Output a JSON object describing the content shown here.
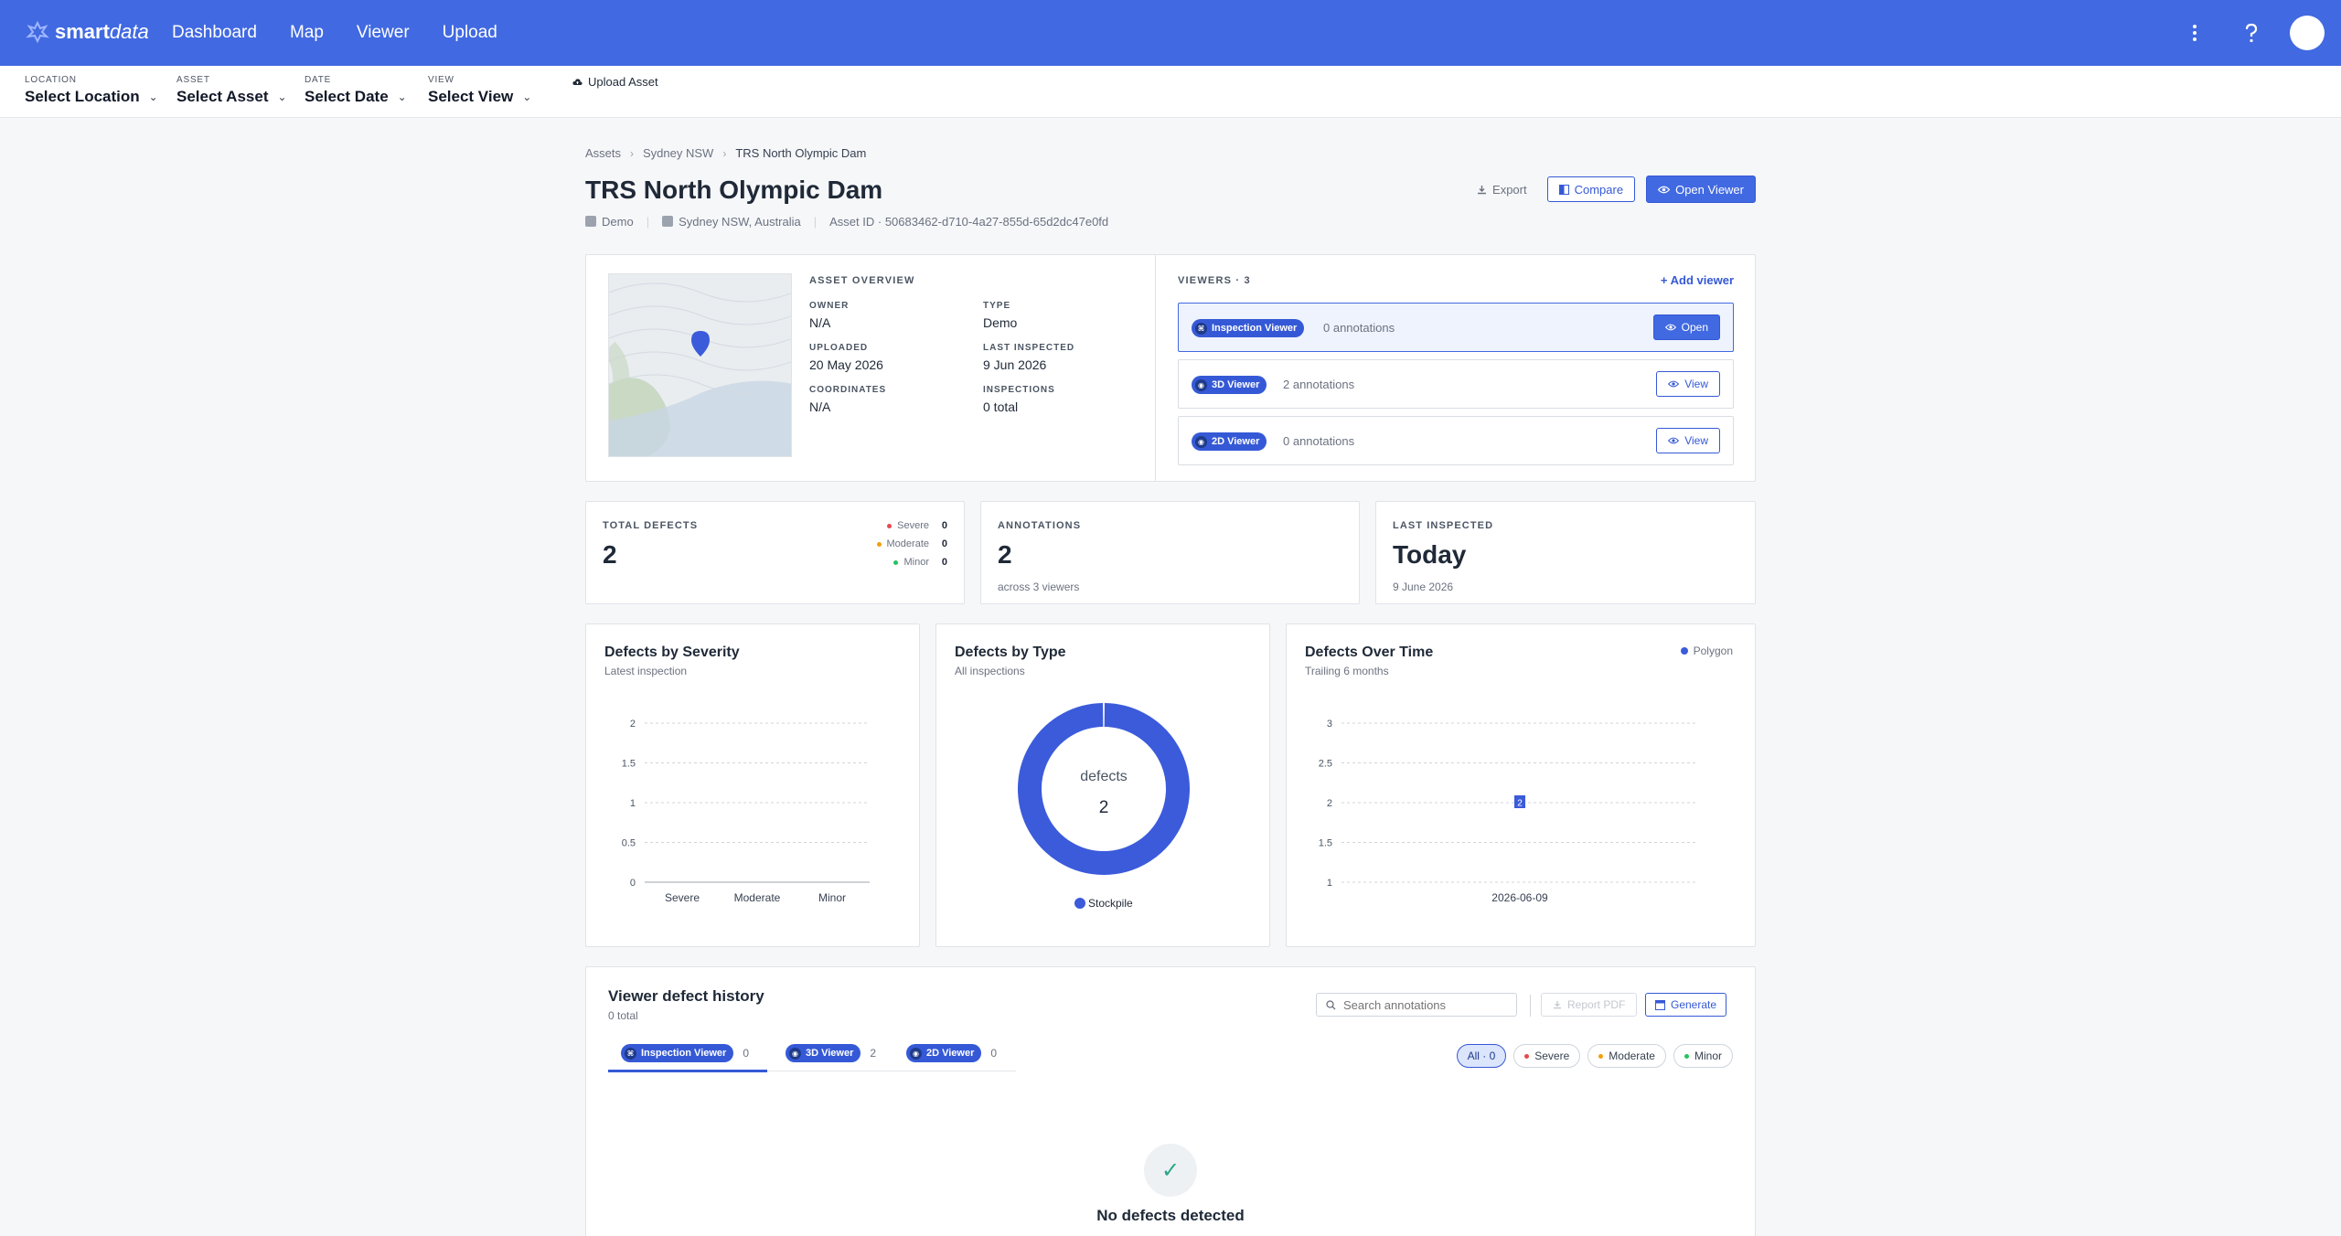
{
  "app": {
    "logo_bold": "smart",
    "logo_light": "data",
    "nav": [
      "Dashboard",
      "Map",
      "Viewer",
      "Upload"
    ]
  },
  "selectors": [
    {
      "label": "LOCATION",
      "value": "Select Location"
    },
    {
      "label": "ASSET",
      "value": "Select Asset"
    },
    {
      "label": "DATE",
      "value": "Select Date"
    },
    {
      "label": "VIEW",
      "value": "Select View"
    }
  ],
  "upload_asset": "Upload Asset",
  "breadcrumb": [
    "Assets",
    "Sydney NSW",
    "TRS North Olympic Dam"
  ],
  "asset": {
    "title": "TRS North Olympic Dam",
    "type_tag": "Demo",
    "location": "Sydney NSW, Australia",
    "asset_id": "Asset ID · 50683462-d710-4a27-855d-65d2dc47e0fd"
  },
  "actions": {
    "export": "Export",
    "compare": "Compare",
    "open_viewer": "Open Viewer"
  },
  "overview": {
    "heading": "ASSET OVERVIEW",
    "fields": [
      {
        "key": "OWNER",
        "value": "N/A"
      },
      {
        "key": "TYPE",
        "value": "Demo"
      },
      {
        "key": "UPLOADED",
        "value": "20 May 2026"
      },
      {
        "key": "LAST INSPECTED",
        "value": "9 Jun 2026"
      },
      {
        "key": "COORDINATES",
        "value": "N/A"
      },
      {
        "key": "INSPECTIONS",
        "value": "0 total"
      }
    ]
  },
  "viewers": {
    "heading": "VIEWERS · 3",
    "add": "+ Add viewer",
    "items": [
      {
        "name": "Inspection Viewer",
        "count": "0 annotations",
        "button": "Open"
      },
      {
        "name": "3D Viewer",
        "count": "2 annotations",
        "button": "View"
      },
      {
        "name": "2D Viewer",
        "count": "0 annotations",
        "button": "View"
      }
    ]
  },
  "stats": {
    "total_defects": {
      "label": "TOTAL DEFECTS",
      "value": "2",
      "severity": [
        {
          "name": "Severe",
          "count": "0",
          "color": "#e5484d"
        },
        {
          "name": "Moderate",
          "count": "0",
          "color": "#f59e0b"
        },
        {
          "name": "Minor",
          "count": "0",
          "color": "#22c55e"
        }
      ]
    },
    "annotations": {
      "label": "ANNOTATIONS",
      "value": "2",
      "sub": "across 3 viewers"
    },
    "last_inspected": {
      "label": "LAST INSPECTED",
      "value": "Today",
      "sub": "9 June 2026"
    }
  },
  "charts": {
    "severity": {
      "title": "Defects by Severity",
      "subtitle": "Latest inspection"
    },
    "type": {
      "title": "Defects by Type",
      "subtitle": "All inspections",
      "center_label": "defects",
      "center_value": "2"
    },
    "time": {
      "title": "Defects Over Time",
      "subtitle": "Trailing 6 months"
    }
  },
  "chart_data": [
    {
      "type": "bar",
      "title": "Defects by Severity",
      "subtitle": "Latest inspection",
      "categories": [
        "Severe",
        "Moderate",
        "Minor"
      ],
      "values": [
        0,
        0,
        0
      ],
      "ylim": [
        0,
        2
      ],
      "yticks": [
        "0",
        "0.5",
        "1",
        "1.5",
        "2"
      ],
      "grid": true
    },
    {
      "type": "pie",
      "title": "Defects by Type",
      "subtitle": "All inspections",
      "labels": [
        "Stockpile"
      ],
      "values": [
        2
      ],
      "colors": [
        "#3b5bdb"
      ],
      "donut": true,
      "legend": "bottom"
    },
    {
      "type": "line",
      "title": "Defects Over Time",
      "subtitle": "Trailing 6 months",
      "x": [
        "2026-06-09"
      ],
      "series": [
        {
          "name": "Polygon",
          "values": [
            2
          ]
        }
      ],
      "ylim": [
        1,
        3
      ],
      "yticks": [
        "1",
        "1.5",
        "2",
        "2.5",
        "3"
      ],
      "data_labels": [
        "2"
      ],
      "legend": "top-right",
      "grid": true
    }
  ],
  "history": {
    "title": "Viewer defect history",
    "subtitle": "0 total",
    "search_placeholder": "Search annotations",
    "report_pdf": "Report PDF",
    "generate": "Generate",
    "tabs": [
      {
        "name": "Inspection Viewer",
        "count": "0"
      },
      {
        "name": "3D Viewer",
        "count": "2"
      },
      {
        "name": "2D Viewer",
        "count": "0"
      }
    ],
    "filters": [
      {
        "label": "All · 0",
        "color": ""
      },
      {
        "label": "Severe",
        "color": "#e5484d"
      },
      {
        "label": "Moderate",
        "color": "#f59e0b"
      },
      {
        "label": "Minor",
        "color": "#22c55e"
      }
    ],
    "empty": "No defects detected"
  },
  "colors": {
    "brand": "#4169e1",
    "accent": "#3559d6",
    "chart": "#3b5bdb"
  }
}
